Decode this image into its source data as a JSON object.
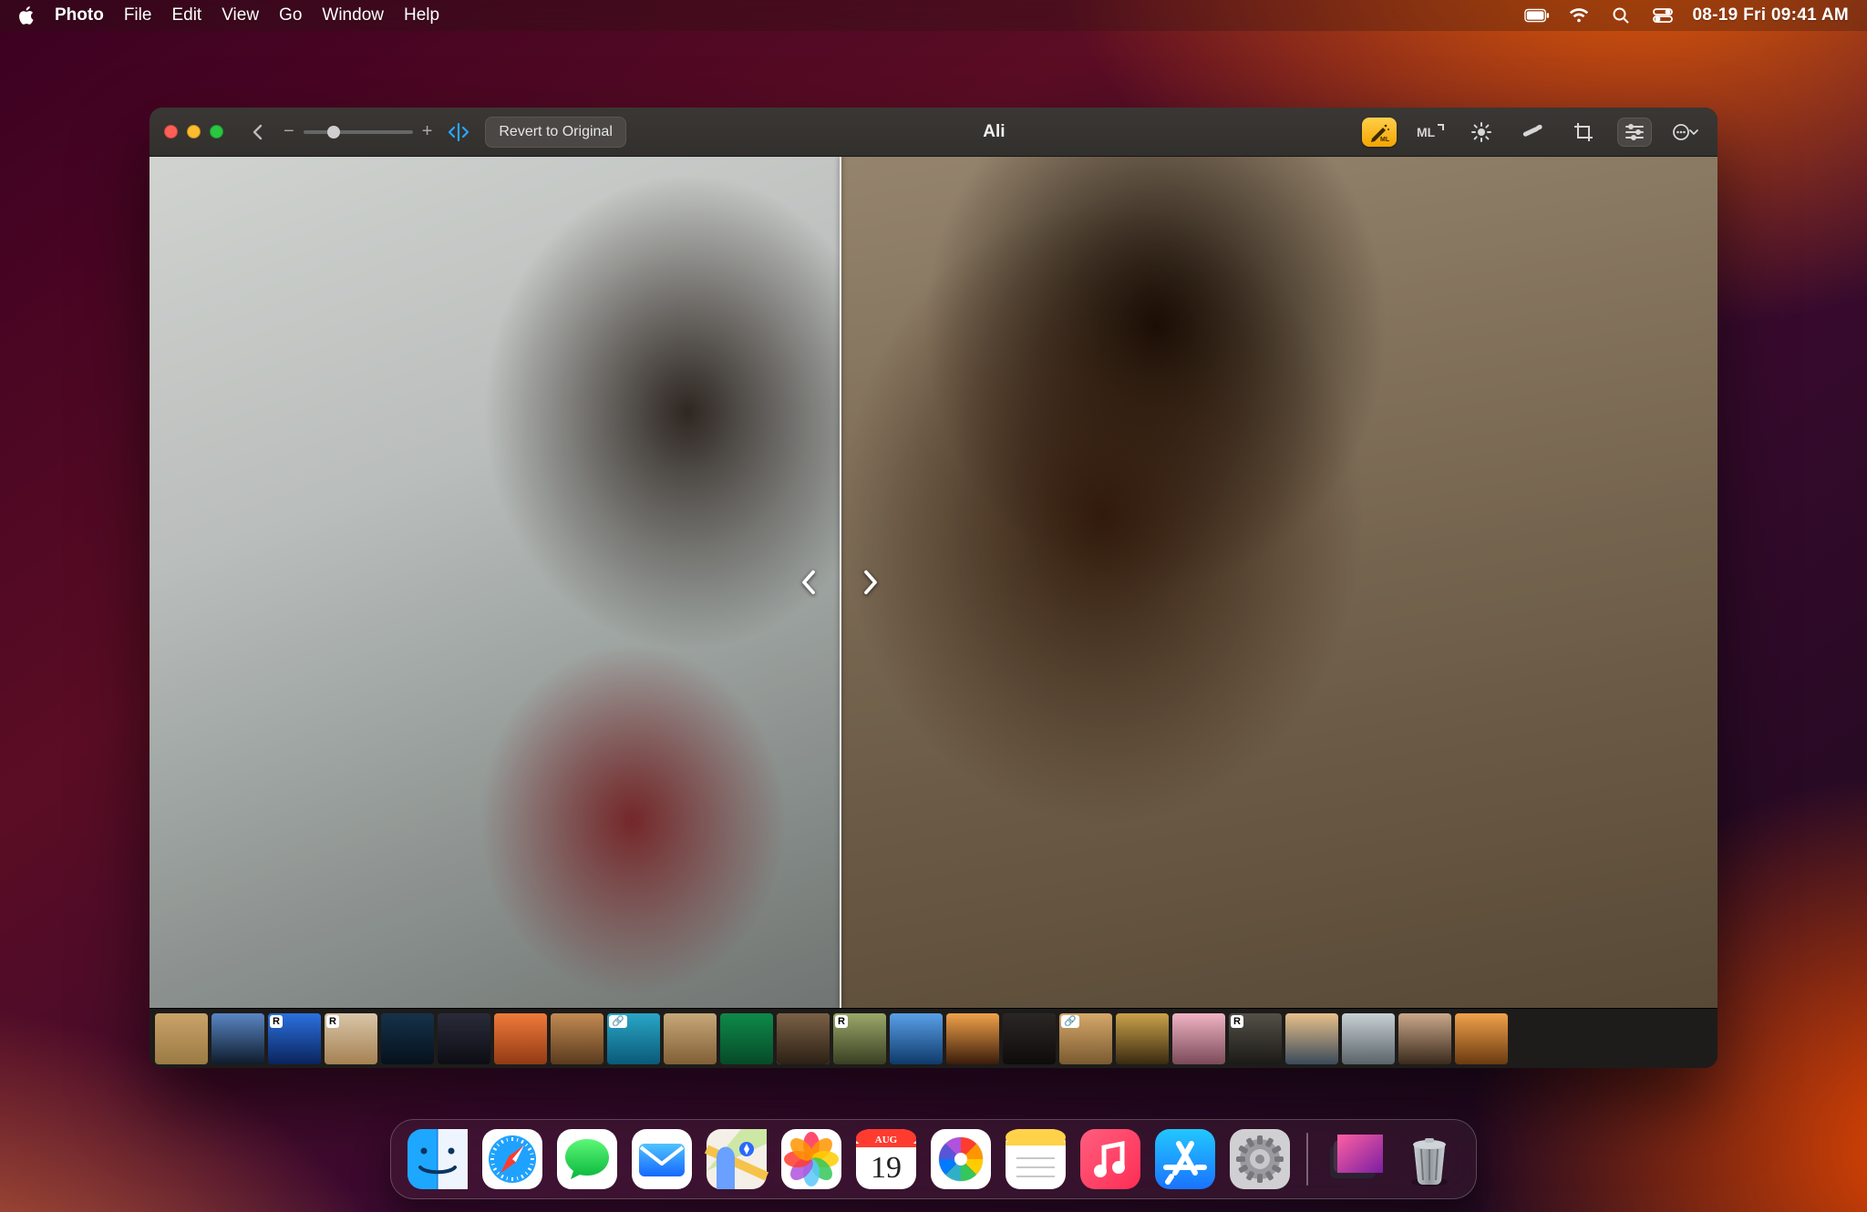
{
  "menu": {
    "app": "Photo",
    "items": [
      "File",
      "Edit",
      "View",
      "Go",
      "Window",
      "Help"
    ],
    "clock": "08-19 Fri  09:41 AM"
  },
  "window": {
    "title": "Ali",
    "revert_label": "Revert to Original",
    "compare_split_percent": 44,
    "tools": {
      "auto_enhance": "Auto Enhance (ML)",
      "ml": "ML",
      "light": "Light",
      "retouch": "Retouch",
      "crop": "Crop",
      "adjust": "Adjust",
      "more": "More"
    }
  },
  "thumbnails": [
    {
      "name": "pyramid",
      "badge": null,
      "bg": "linear-gradient(#caa368,#9a7a44)"
    },
    {
      "name": "silhouette",
      "badge": null,
      "bg": "linear-gradient(#5a86c4,#0e1b2b)"
    },
    {
      "name": "portrait-curly",
      "badge": "R",
      "bg": "linear-gradient(#2b70e0,#0a245a)"
    },
    {
      "name": "canyon",
      "badge": "R",
      "bg": "linear-gradient(#d9c6a8,#a58153)"
    },
    {
      "name": "guitar-night",
      "badge": null,
      "bg": "linear-gradient(#15324a,#06111c)"
    },
    {
      "name": "dusk-walk",
      "badge": null,
      "bg": "linear-gradient(#2a2b3a,#0c0d14)"
    },
    {
      "name": "runner-orange",
      "badge": null,
      "bg": "linear-gradient(#f07a3a,#913a14)"
    },
    {
      "name": "profile-warm",
      "badge": null,
      "bg": "linear-gradient(#c28a52,#5a3b1e)"
    },
    {
      "name": "surfer",
      "badge": "🔗",
      "bg": "linear-gradient(#2aa6c6,#0a5a78)"
    },
    {
      "name": "arch",
      "badge": null,
      "bg": "linear-gradient(#c7a878,#805f36)"
    },
    {
      "name": "green-wall",
      "badge": null,
      "bg": "linear-gradient(#0e8a4a,#064a28)"
    },
    {
      "name": "ali-closeup",
      "badge": null,
      "bg": "linear-gradient(#7a6146,#2c2015)",
      "selected": true
    },
    {
      "name": "hills",
      "badge": "R",
      "bg": "linear-gradient(#9aa86a,#3a3f22)"
    },
    {
      "name": "afro-sky",
      "badge": null,
      "bg": "linear-gradient(#5aa0e8,#0e3a6a)"
    },
    {
      "name": "sunset-road",
      "badge": null,
      "bg": "linear-gradient(#f2a24a,#3a1c0a)"
    },
    {
      "name": "profile-dark",
      "badge": null,
      "bg": "linear-gradient(#2a2624,#0e0c0b)"
    },
    {
      "name": "desert-walk",
      "badge": "🔗",
      "bg": "linear-gradient(#d6a86a,#7a5a30)"
    },
    {
      "name": "bokeh",
      "badge": null,
      "bg": "linear-gradient(#caa24a,#3a2a10)"
    },
    {
      "name": "visor",
      "badge": null,
      "bg": "linear-gradient(#f0b4c4,#7a4a58)"
    },
    {
      "name": "crowd",
      "badge": "R",
      "bg": "linear-gradient(#545048,#1c1a16)"
    },
    {
      "name": "dawn-sky",
      "badge": null,
      "bg": "linear-gradient(#e8c08a,#3a4a5a)"
    },
    {
      "name": "plane",
      "badge": null,
      "bg": "linear-gradient(#c8d0d4,#5a6468)"
    },
    {
      "name": "afro-studio",
      "badge": null,
      "bg": "linear-gradient(#caa88a,#3a2a1c)"
    },
    {
      "name": "bridge",
      "badge": null,
      "bg": "linear-gradient(#f0a24a,#6a3a10)"
    }
  ],
  "dock": {
    "apps": [
      {
        "name": "finder"
      },
      {
        "name": "safari"
      },
      {
        "name": "messages"
      },
      {
        "name": "mail"
      },
      {
        "name": "maps"
      },
      {
        "name": "photos"
      },
      {
        "name": "calendar",
        "month": "AUG",
        "day": "19"
      },
      {
        "name": "color-picker"
      },
      {
        "name": "notes"
      },
      {
        "name": "music"
      },
      {
        "name": "app-store"
      },
      {
        "name": "settings"
      }
    ],
    "right": [
      {
        "name": "desktop-stack"
      },
      {
        "name": "trash"
      }
    ]
  }
}
